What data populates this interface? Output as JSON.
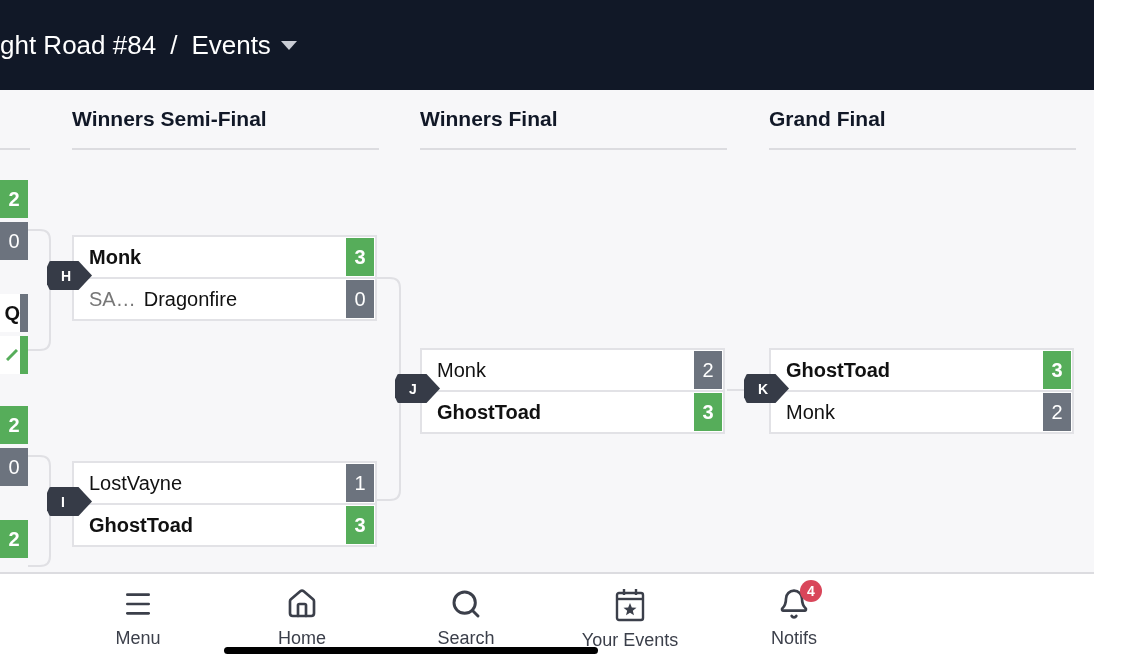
{
  "header": {
    "event": "ght Road #84",
    "separator": "/",
    "section": "Events",
    "dropdown": true
  },
  "partial_round": {
    "slots": [
      {
        "kind": "score",
        "score": "2",
        "winner": true
      },
      {
        "kind": "score",
        "score": "0",
        "winner": false
      },
      {
        "kind": "name",
        "name": "Q",
        "winner": false
      },
      {
        "kind": "check",
        "winner": true
      },
      {
        "kind": "score",
        "score": "2",
        "winner": true
      },
      {
        "kind": "score",
        "score": "0",
        "winner": false
      },
      {
        "kind": "score",
        "score": "2",
        "winner": true
      }
    ]
  },
  "rounds": [
    {
      "title": "Winners Semi-Final",
      "matches": [
        {
          "label": "H",
          "slots": [
            {
              "name": "Monk",
              "score": "3",
              "winner": true
            },
            {
              "prefix": "SA…",
              "name": "Dragonfire",
              "score": "0",
              "winner": false
            }
          ]
        },
        {
          "label": "I",
          "slots": [
            {
              "name": "LostVayne",
              "score": "1",
              "winner": false
            },
            {
              "name": "GhostToad",
              "score": "3",
              "winner": true
            }
          ]
        }
      ]
    },
    {
      "title": "Winners Final",
      "matches": [
        {
          "label": "J",
          "slots": [
            {
              "name": "Monk",
              "score": "2",
              "winner": false
            },
            {
              "name": "GhostToad",
              "score": "3",
              "winner": true
            }
          ]
        }
      ]
    },
    {
      "title": "Grand Final",
      "matches": [
        {
          "label": "K",
          "slots": [
            {
              "name": "GhostToad",
              "score": "3",
              "winner": true
            },
            {
              "name": "Monk",
              "score": "2",
              "winner": false
            }
          ]
        }
      ]
    }
  ],
  "nav": [
    {
      "kind": "menu",
      "label": "Menu"
    },
    {
      "kind": "home",
      "label": "Home"
    },
    {
      "kind": "search",
      "label": "Search"
    },
    {
      "kind": "events",
      "label": "Your Events"
    },
    {
      "kind": "notifs",
      "label": "Notifs",
      "badge": "4"
    }
  ]
}
